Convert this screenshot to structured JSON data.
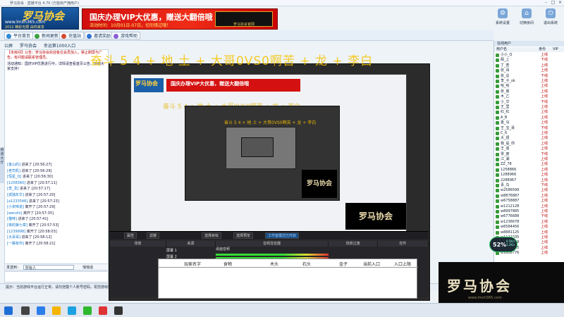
{
  "window": {
    "title": "罗马协会 · 直播平台 4.70 (万能房产拥用户)"
  },
  "logo": {
    "big": "罗马协会",
    "url": "www.lmxh365.com",
    "tag": "2012 精彩无限 由你来享"
  },
  "banner": {
    "title": "国庆办理VIP大优惠，赠送大翻倍哦",
    "sub": "活动时间：10月01日-07日，切勿错过哦！",
    "badge": "罗马协会官网"
  },
  "top_icons": [
    {
      "label": "系统设置",
      "glyph": "⚙"
    },
    {
      "label": "切换房间",
      "glyph": "⌂"
    },
    {
      "label": "退出系统",
      "glyph": "⏻"
    }
  ],
  "toolbar": [
    {
      "label": "平台首页",
      "color": "#2e8bd6"
    },
    {
      "label": "新闻更新",
      "color": "#3aa141"
    },
    {
      "label": "充值站",
      "color": "#d6492e"
    },
    {
      "label": "邀请奖励",
      "color": "#2e73d6"
    },
    {
      "label": "游戏帮助",
      "color": "#8a5dd6"
    }
  ],
  "tabs": [
    "公屏",
    "罗马协会",
    "幸运第1000入口"
  ],
  "announcements": [
    {
      "text": "【本房间】公告：罗马协会欢迎各位会员加入，禁止刷屏与广告，有问题请联系管理员。",
      "cls": ""
    },
    {
      "text": "活动通知：国庆VIP优惠进行中，详情请查看首页公告，感谢大家支持！",
      "cls": "blue"
    }
  ],
  "side_tab": "频道大厅",
  "logs": [
    {
      "name": "[金山的]",
      "act": "进来了 [20:56:27]"
    },
    {
      "name": "[老司机]",
      "act": "进来了 [20:56:29]"
    },
    {
      "name": "[恒星_Q]",
      "act": "进来了 [20:56:30]"
    },
    {
      "name": "[1258360]",
      "act": "进来了 [20:57:11]"
    },
    {
      "name": "[李_龙]",
      "act": "进来了 [20:57:17]"
    },
    {
      "name": "[孤独年华]",
      "act": "进来了 [20:57:20]"
    },
    {
      "name": "[a1233546]",
      "act": "进来了 [20:57:23]"
    },
    {
      "name": "[小资味道]",
      "act": "离开了 [20:57:29]"
    },
    {
      "name": "[wenzhi]",
      "act": "离开了 [20:57:35]"
    },
    {
      "name": "[猫咪]",
      "act": "进来了 [20:57:41]"
    },
    {
      "name": "[夜的第七章]",
      "act": "离开了 [20:57:53]"
    },
    {
      "name": "[1239998]",
      "act": "离开了 [20:58:03]"
    },
    {
      "name": "[大哥哥]",
      "act": "进来了 [20:58:12]"
    },
    {
      "name": "[一路有你]",
      "act": "离开了 [20:58:21]"
    }
  ],
  "input": {
    "label": "发送到：",
    "placeholder": "所有人",
    "private": "悄悄话"
  },
  "status": "提示：当前游戏平台运行正常，请勿泄露个人账号密码，祝您游戏愉快！",
  "right_panel": {
    "tabs": "在线用户",
    "headers": [
      "用户名",
      "身份",
      "VIP"
    ],
    "users": [
      {
        "n": "小小_Q",
        "r": "上线"
      },
      {
        "n": "陌_上",
        "r": "下线"
      },
      {
        "n": "丁_若",
        "r": "上线"
      },
      {
        "n": "张_哥",
        "r": "上线"
      },
      {
        "n": "张_总",
        "r": "下线"
      },
      {
        "n": "李_子_ok",
        "r": "上线"
      },
      {
        "n": "哈_哈",
        "r": "上线"
      },
      {
        "n": "张_晨",
        "r": "上线"
      },
      {
        "n": "木_乙",
        "r": "上线"
      },
      {
        "n": "小_华",
        "r": "下线"
      },
      {
        "n": "王_里",
        "r": "上线"
      },
      {
        "n": "红_红",
        "r": "上线"
      },
      {
        "n": "A_B",
        "r": "上线"
      },
      {
        "n": "金_马",
        "r": "上线"
      },
      {
        "n": "王_宝_哥",
        "r": "下线"
      },
      {
        "n": "C_6",
        "r": "上线"
      },
      {
        "n": "大_妞",
        "r": "上线"
      },
      {
        "n": "我_是_你",
        "r": "上线"
      },
      {
        "n": "王_强",
        "r": "上线"
      },
      {
        "n": "零_度",
        "r": "下线"
      },
      {
        "n": "江_湖",
        "r": "上线"
      },
      {
        "n": "ZZ_78",
        "r": "上线"
      },
      {
        "n": "1258866",
        "r": "上线"
      },
      {
        "n": "1288966",
        "r": "上线"
      },
      {
        "n": "2288967",
        "r": "上线"
      },
      {
        "n": "青_鸟",
        "r": "下线"
      },
      {
        "n": "w2586599",
        "r": "上线"
      },
      {
        "n": "w8876887",
        "r": "上线"
      },
      {
        "n": "w6758887",
        "r": "上线"
      },
      {
        "n": "w1212128",
        "r": "上线"
      },
      {
        "n": "w8997885",
        "r": "上线"
      },
      {
        "n": "w6776688",
        "r": "下线"
      },
      {
        "n": "w1236678",
        "r": "上线"
      },
      {
        "n": "w6584456",
        "r": "上线"
      },
      {
        "n": "w8881125",
        "r": "上线"
      },
      {
        "n": "w1122335",
        "r": "上线"
      },
      {
        "n": "w5560998",
        "r": "上线"
      },
      {
        "n": "w6677885",
        "r": "上线"
      },
      {
        "n": "w9988776",
        "r": "上线"
      }
    ]
  },
  "net_widget": {
    "pct": "52%",
    "up": "0.5K/s",
    "down": "1.2K/s"
  },
  "overlay_watermark": "奋斗 5 4 + 地 土 + 大哥0VS0啊苦 + 龙 + 李白",
  "obs": {
    "dock": [
      "属性",
      "滤镜",
      "选择目标",
      "选择预览",
      "工作室模式已开启"
    ],
    "panels": [
      "场景",
      "来源",
      "音频混音器",
      "场景过渡",
      "控件"
    ],
    "scenes": [
      "屏幕 1",
      "屏幕 2"
    ],
    "mixer_label": "桌面音频"
  },
  "table": {
    "headers": [
      "玩家名字",
      "食物",
      "木头",
      "石头",
      "金子",
      "当前入口",
      "入口上限"
    ]
  },
  "brand": {
    "name": "罗马协会",
    "url": "www.lmxh365.com"
  }
}
